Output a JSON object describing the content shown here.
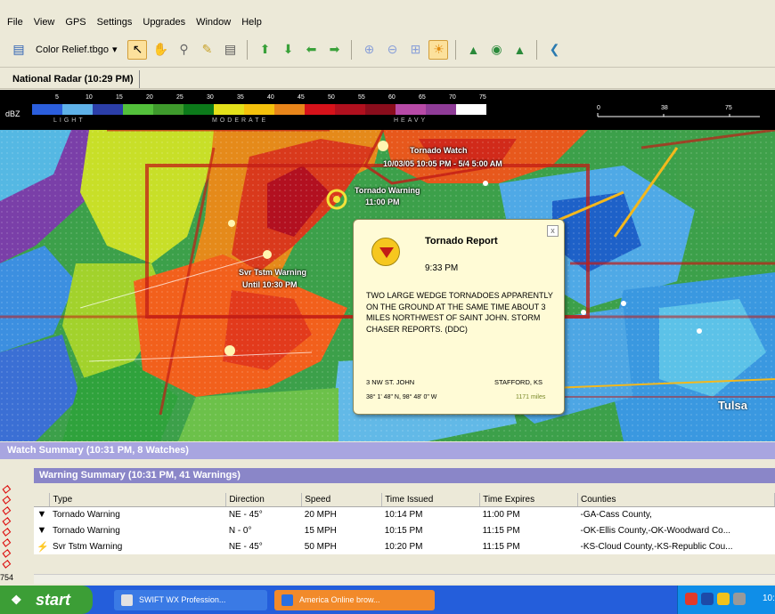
{
  "menu": [
    "File",
    "View",
    "GPS",
    "Settings",
    "Upgrades",
    "Window",
    "Help"
  ],
  "toolbar": {
    "map_style": "Color Relief.tbgo",
    "icons": [
      "save-icon",
      "select-arrow-icon",
      "pan-hand-icon",
      "zoom-icon",
      "pencil-icon",
      "measure-icon",
      "arrow-up-icon",
      "arrow-down-icon",
      "arrow-left-icon",
      "arrow-right-icon",
      "zoom-in-icon",
      "zoom-out-icon",
      "zoom-fit-icon",
      "sun-icon",
      "tree-icon",
      "target-icon",
      "flame-icon",
      "back-icon"
    ]
  },
  "layer_tab": "National Radar (10:29 PM)",
  "legend": {
    "unit": "dBZ",
    "ticks": [
      "5",
      "10",
      "15",
      "20",
      "25",
      "30",
      "35",
      "40",
      "45",
      "50",
      "55",
      "60",
      "65",
      "70",
      "75"
    ],
    "colors": [
      "#2b5edc",
      "#5eb1e8",
      "#2b3ea8",
      "#53c03b",
      "#3e9a2c",
      "#0c7a1a",
      "#e3e01a",
      "#f4c10c",
      "#e8851a",
      "#d6121a",
      "#b0101e",
      "#8a0d1c",
      "#b74aa6",
      "#8f3c97",
      "#ffffff"
    ],
    "categories": [
      "LIGHT",
      "MODERATE",
      "HEAVY"
    ],
    "scale": [
      "0",
      "38",
      "75"
    ]
  },
  "map_labels": [
    {
      "text": "Tornado Watch",
      "name": "tornado-watch-label"
    },
    {
      "text": "10/03/05 10:05 PM - 5/4 5:00 AM",
      "name": "watch-time-label"
    },
    {
      "text": "Tornado Warning",
      "name": "tornado-warning-label"
    },
    {
      "text": "11:00 PM",
      "name": "warning-expire-label"
    },
    {
      "text": "Svr Tstm Warning",
      "name": "svr-tstm-warning-label"
    },
    {
      "text": "Until 10:30 PM",
      "name": "until-label"
    },
    {
      "text": "Tulsa",
      "name": "city-tulsa"
    }
  ],
  "popup": {
    "title": "Tornado Report",
    "time": "9:33 PM",
    "body": "TWO LARGE WEDGE TORNADOES APPARENTLY ON THE GROUND AT THE SAME TIME ABOUT 3 MILES NORTHWEST OF SAINT JOHN. STORM CHASER REPORTS. (DDC)",
    "location": "3 NW ST. JOHN",
    "state": "STAFFORD, KS",
    "coords": "38° 1' 48\" N, 98° 48' 0\" W",
    "distance": "1171 miles",
    "close": "x"
  },
  "watch_summary": "Watch Summary (10:31 PM, 8 Watches)",
  "warning_summary": {
    "title": "Warning Summary (10:31 PM, 41 Warnings)",
    "columns": [
      "Type",
      "Direction",
      "Speed",
      "Time Issued",
      "Time Expires",
      "Counties"
    ],
    "rows": [
      {
        "icon": "tornado-icon",
        "type": "Tornado Warning",
        "direction": "NE - 45°",
        "speed": "20 MPH",
        "issued": "10:14 PM",
        "expires": "11:00 PM",
        "counties": "-GA-Cass County,"
      },
      {
        "icon": "tornado-icon",
        "type": "Tornado Warning",
        "direction": "N - 0°",
        "speed": "15 MPH",
        "issued": "10:15 PM",
        "expires": "11:15 PM",
        "counties": "-OK-Ellis County,-OK-Woodward Co..."
      },
      {
        "icon": "lightning-icon",
        "type": "Svr Tstm Warning",
        "direction": "NE - 45°",
        "speed": "50 MPH",
        "issued": "10:20 PM",
        "expires": "11:15 PM",
        "counties": "-KS-Cloud County,-KS-Republic Cou..."
      }
    ],
    "row_count": "754"
  },
  "taskbar": {
    "start": "start",
    "tasks": [
      "SWIFT WX Profession...",
      "America Online brow..."
    ],
    "clock": "10:"
  }
}
